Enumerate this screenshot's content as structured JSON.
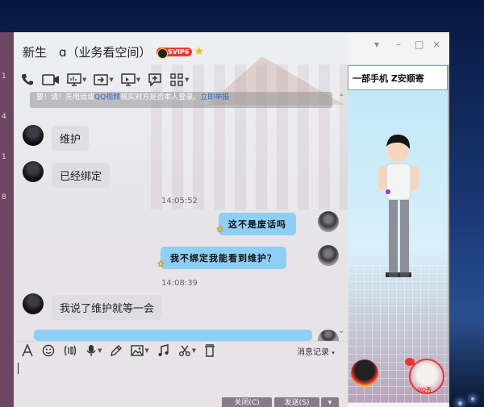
{
  "window": {
    "title": "新生　ɑ（业务看空间）",
    "vip_label": "SVIP6",
    "controls": [
      "▾",
      "–",
      "□",
      "×"
    ]
  },
  "left_strip": {
    "labels": [
      "1",
      "4",
      "1",
      "8"
    ]
  },
  "notice": {
    "text_before": "要！请！先电话或",
    "link1": "QQ视频",
    "text_mid": "核实对方是否本人登录。",
    "link2": "立即举报"
  },
  "messages": [
    {
      "side": "left",
      "text": "维护"
    },
    {
      "side": "left",
      "text": "已经绑定"
    },
    {
      "side": "time",
      "text": "14:05:52"
    },
    {
      "side": "right",
      "text": "这不是废话吗"
    },
    {
      "side": "right",
      "text": "我不绑定我能看到维护？"
    },
    {
      "side": "time",
      "text": "14:08:39"
    },
    {
      "side": "left",
      "text": "我说了维护就等一会"
    }
  ],
  "history_label": "消息记录",
  "input": {
    "value": ""
  },
  "buttons": {
    "close": "关闭(C)",
    "send": "发送(S)"
  },
  "side_panel": {
    "marquee_text": "一部手机  Z安顺寄"
  },
  "avatar_watermark": "QQ秀"
}
